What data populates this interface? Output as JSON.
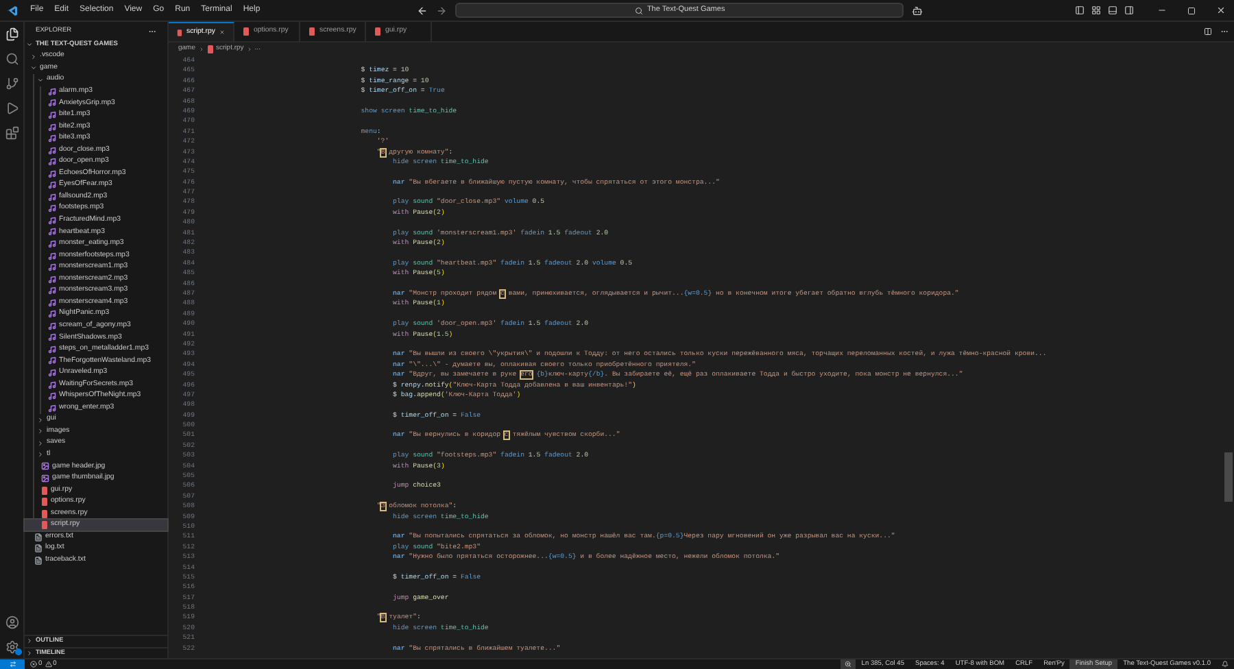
{
  "menu": [
    "File",
    "Edit",
    "Selection",
    "View",
    "Go",
    "Run",
    "Terminal",
    "Help"
  ],
  "search": {
    "value": "The Text-Quest Games"
  },
  "explorer": {
    "title": "EXPLORER",
    "root": "THE TEXT-QUEST GAMES",
    "tree": [
      {
        "label": ".vscode",
        "kind": "folder",
        "expanded": false,
        "selected": false
      },
      {
        "label": "game",
        "kind": "folder",
        "expanded": true,
        "selected": false,
        "children": [
          {
            "label": "audio",
            "kind": "folder",
            "expanded": true,
            "selected": false,
            "children": [
              {
                "label": "alarm.mp3",
                "kind": "audio",
                "selected": false
              },
              {
                "label": "AnxietysGrip.mp3",
                "kind": "audio",
                "selected": false
              },
              {
                "label": "bite1.mp3",
                "kind": "audio",
                "selected": false
              },
              {
                "label": "bite2.mp3",
                "kind": "audio",
                "selected": false
              },
              {
                "label": "bite3.mp3",
                "kind": "audio",
                "selected": false
              },
              {
                "label": "door_close.mp3",
                "kind": "audio",
                "selected": false
              },
              {
                "label": "door_open.mp3",
                "kind": "audio",
                "selected": false
              },
              {
                "label": "EchoesOfHorror.mp3",
                "kind": "audio",
                "selected": false
              },
              {
                "label": "EyesOfFear.mp3",
                "kind": "audio",
                "selected": false
              },
              {
                "label": "fallsound2.mp3",
                "kind": "audio",
                "selected": false
              },
              {
                "label": "footsteps.mp3",
                "kind": "audio",
                "selected": false
              },
              {
                "label": "FracturedMind.mp3",
                "kind": "audio",
                "selected": false
              },
              {
                "label": "heartbeat.mp3",
                "kind": "audio",
                "selected": false
              },
              {
                "label": "monster_eating.mp3",
                "kind": "audio",
                "selected": false
              },
              {
                "label": "monsterfootsteps.mp3",
                "kind": "audio",
                "selected": false
              },
              {
                "label": "monsterscream1.mp3",
                "kind": "audio",
                "selected": false
              },
              {
                "label": "monsterscream2.mp3",
                "kind": "audio",
                "selected": false
              },
              {
                "label": "monsterscream3.mp3",
                "kind": "audio",
                "selected": false
              },
              {
                "label": "monsterscream4.mp3",
                "kind": "audio",
                "selected": false
              },
              {
                "label": "NightPanic.mp3",
                "kind": "audio",
                "selected": false
              },
              {
                "label": "scream_of_agony.mp3",
                "kind": "audio",
                "selected": false
              },
              {
                "label": "SilentShadows.mp3",
                "kind": "audio",
                "selected": false
              },
              {
                "label": "steps_on_metalladder1.mp3",
                "kind": "audio",
                "selected": false
              },
              {
                "label": "TheForgottenWasteland.mp3",
                "kind": "audio",
                "selected": false
              },
              {
                "label": "Unraveled.mp3",
                "kind": "audio",
                "selected": false
              },
              {
                "label": "WaitingForSecrets.mp3",
                "kind": "audio",
                "selected": false
              },
              {
                "label": "WhispersOfTheNight.mp3",
                "kind": "audio",
                "selected": false
              },
              {
                "label": "wrong_enter.mp3",
                "kind": "audio",
                "selected": false
              }
            ]
          },
          {
            "label": "gui",
            "kind": "folder",
            "expanded": false,
            "selected": false
          },
          {
            "label": "images",
            "kind": "folder",
            "expanded": false,
            "selected": false
          },
          {
            "label": "saves",
            "kind": "folder",
            "expanded": false,
            "selected": false
          },
          {
            "label": "tl",
            "kind": "folder",
            "expanded": false,
            "selected": false
          },
          {
            "label": "game header.jpg",
            "kind": "image",
            "selected": false
          },
          {
            "label": "game thumbnail.jpg",
            "kind": "image",
            "selected": false
          },
          {
            "label": "gui.rpy",
            "kind": "renpy",
            "selected": false
          },
          {
            "label": "options.rpy",
            "kind": "renpy",
            "selected": false
          },
          {
            "label": "screens.rpy",
            "kind": "renpy",
            "selected": false
          },
          {
            "label": "script.rpy",
            "kind": "renpy",
            "selected": true
          }
        ]
      },
      {
        "label": "errors.txt",
        "kind": "text",
        "selected": false
      },
      {
        "label": "log.txt",
        "kind": "text",
        "selected": false
      },
      {
        "label": "traceback.txt",
        "kind": "text",
        "selected": false
      }
    ],
    "sections": [
      {
        "label": "OUTLINE",
        "expanded": false
      },
      {
        "label": "TIMELINE",
        "expanded": false
      }
    ]
  },
  "tabs": [
    {
      "label": "script.rpy",
      "selected": true
    },
    {
      "label": "options.rpy",
      "selected": false
    },
    {
      "label": "screens.rpy",
      "selected": false
    },
    {
      "label": "gui.rpy",
      "selected": false
    }
  ],
  "breadcrumb": [
    "game",
    "script.rpy",
    "..."
  ],
  "code": [
    {
      "number": "464"
    },
    {
      "number": "465",
      "tokens": [
        {
          "kind": "plain",
          "text": "$ "
        },
        {
          "kind": "var",
          "text": "timez"
        },
        {
          "kind": "plain",
          "text": " = "
        },
        {
          "kind": "num",
          "text": "10"
        }
      ]
    },
    {
      "number": "466",
      "tokens": [
        {
          "kind": "plain",
          "text": "$ "
        },
        {
          "kind": "var",
          "text": "time_range"
        },
        {
          "kind": "plain",
          "text": " = "
        },
        {
          "kind": "num",
          "text": "10"
        }
      ]
    },
    {
      "number": "467",
      "tokens": [
        {
          "kind": "plain",
          "text": "$ "
        },
        {
          "kind": "var",
          "text": "timer_off_on"
        },
        {
          "kind": "plain",
          "text": " = "
        },
        {
          "kind": "kw",
          "text": "True"
        }
      ]
    },
    {
      "number": "468"
    },
    {
      "number": "469",
      "tokens": [
        {
          "kind": "kw",
          "text": "show "
        },
        {
          "kind": "kw",
          "text": "screen "
        },
        {
          "kind": "name",
          "text": "time_to_hide"
        }
      ]
    },
    {
      "number": "470"
    },
    {
      "number": "471",
      "tokens": [
        {
          "kind": "kw",
          "text": "menu"
        },
        {
          "kind": "plain",
          "text": ":"
        }
      ],
      "children": [
        {
          "number": "472",
          "tokens": [
            {
              "kind": "str",
              "text": "'?'"
            }
          ]
        },
        {
          "number": "473",
          "tokens": [
            {
              "kind": "str",
              "text": "\""
            },
            {
              "kind": "amb",
              "text": "В"
            },
            {
              "kind": "str",
              "text": " другую комнату\""
            },
            {
              "kind": "plain",
              "text": ":"
            }
          ],
          "children": [
            {
              "number": "474",
              "tokens": [
                {
                  "kind": "kw",
                  "text": "hide "
                },
                {
                  "kind": "kw",
                  "text": "screen "
                },
                {
                  "kind": "name",
                  "text": "time_to_hide"
                }
              ]
            },
            {
              "number": "475"
            },
            {
              "number": "476",
              "tokens": [
                {
                  "kind": "char",
                  "text": "nar "
                },
                {
                  "kind": "str",
                  "text": "\"Вы вбегаете в ближайшую пустую комнату, чтобы спрятаться от этого монстра...\""
                }
              ]
            },
            {
              "number": "477"
            },
            {
              "number": "478",
              "tokens": [
                {
                  "kind": "kw",
                  "text": "play "
                },
                {
                  "kind": "name",
                  "text": "sound "
                },
                {
                  "kind": "str",
                  "text": "\"door_close.mp3\" "
                },
                {
                  "kind": "kw",
                  "text": "volume "
                },
                {
                  "kind": "num",
                  "text": "0.5"
                }
              ]
            },
            {
              "number": "479",
              "tokens": [
                {
                  "kind": "ctrl",
                  "text": "with "
                },
                {
                  "kind": "fn",
                  "text": "Pause"
                },
                {
                  "kind": "paren",
                  "text": "("
                },
                {
                  "kind": "num",
                  "text": "2"
                },
                {
                  "kind": "paren",
                  "text": ")"
                }
              ]
            },
            {
              "number": "480"
            },
            {
              "number": "481",
              "tokens": [
                {
                  "kind": "kw",
                  "text": "play "
                },
                {
                  "kind": "name",
                  "text": "sound "
                },
                {
                  "kind": "str",
                  "text": "'monsterscream1.mp3' "
                },
                {
                  "kind": "kw",
                  "text": "fadein "
                },
                {
                  "kind": "num",
                  "text": "1.5 "
                },
                {
                  "kind": "kw",
                  "text": "fadeout "
                },
                {
                  "kind": "num",
                  "text": "2.0"
                }
              ]
            },
            {
              "number": "482",
              "tokens": [
                {
                  "kind": "ctrl",
                  "text": "with "
                },
                {
                  "kind": "fn",
                  "text": "Pause"
                },
                {
                  "kind": "paren",
                  "text": "("
                },
                {
                  "kind": "num",
                  "text": "2"
                },
                {
                  "kind": "paren",
                  "text": ")"
                }
              ]
            },
            {
              "number": "483"
            },
            {
              "number": "484",
              "tokens": [
                {
                  "kind": "kw",
                  "text": "play "
                },
                {
                  "kind": "name",
                  "text": "sound "
                },
                {
                  "kind": "str",
                  "text": "\"heartbeat.mp3\" "
                },
                {
                  "kind": "kw",
                  "text": "fadein "
                },
                {
                  "kind": "num",
                  "text": "1.5 "
                },
                {
                  "kind": "kw",
                  "text": "fadeout "
                },
                {
                  "kind": "num",
                  "text": "2.0 "
                },
                {
                  "kind": "kw",
                  "text": "volume "
                },
                {
                  "kind": "num",
                  "text": "0.5"
                }
              ]
            },
            {
              "number": "485",
              "tokens": [
                {
                  "kind": "ctrl",
                  "text": "with "
                },
                {
                  "kind": "fn",
                  "text": "Pause"
                },
                {
                  "kind": "paren",
                  "text": "("
                },
                {
                  "kind": "num",
                  "text": "5"
                },
                {
                  "kind": "paren",
                  "text": ")"
                }
              ]
            },
            {
              "number": "486"
            },
            {
              "number": "487",
              "tokens": [
                {
                  "kind": "char",
                  "text": "nar "
                },
                {
                  "kind": "str",
                  "text": "\"Монстр проходит рядом "
                },
                {
                  "kind": "amb",
                  "text": "с"
                },
                {
                  "kind": "str",
                  "text": " вами, принюхивается, оглядывается и рычит..."
                },
                {
                  "kind": "tag",
                  "text": "{w=0.5}"
                },
                {
                  "kind": "str",
                  "text": " но в конечном итоге убегает обратно вглубь тёмного коридора.\""
                }
              ]
            },
            {
              "number": "488",
              "tokens": [
                {
                  "kind": "ctrl",
                  "text": "with "
                },
                {
                  "kind": "fn",
                  "text": "Pause"
                },
                {
                  "kind": "paren",
                  "text": "("
                },
                {
                  "kind": "num",
                  "text": "1"
                },
                {
                  "kind": "paren",
                  "text": ")"
                }
              ]
            },
            {
              "number": "489"
            },
            {
              "number": "490",
              "tokens": [
                {
                  "kind": "kw",
                  "text": "play "
                },
                {
                  "kind": "name",
                  "text": "sound "
                },
                {
                  "kind": "str",
                  "text": "'door_open.mp3' "
                },
                {
                  "kind": "kw",
                  "text": "fadein "
                },
                {
                  "kind": "num",
                  "text": "1.5 "
                },
                {
                  "kind": "kw",
                  "text": "fadeout "
                },
                {
                  "kind": "num",
                  "text": "2.0"
                }
              ]
            },
            {
              "number": "491",
              "tokens": [
                {
                  "kind": "ctrl",
                  "text": "with "
                },
                {
                  "kind": "fn",
                  "text": "Pause"
                },
                {
                  "kind": "paren",
                  "text": "("
                },
                {
                  "kind": "num",
                  "text": "1.5"
                },
                {
                  "kind": "paren",
                  "text": ")"
                }
              ]
            },
            {
              "number": "492"
            },
            {
              "number": "493",
              "tokens": [
                {
                  "kind": "char",
                  "text": "nar "
                },
                {
                  "kind": "str",
                  "text": "\"Вы вышли из своего \\\"укрытия\\\" и подошли к Тодду: от него остались только куски пережёванного мяса, торчащих переломанных костей, и лужа тёмно-красной крови..."
                }
              ]
            },
            {
              "number": "494",
              "tokens": [
                {
                  "kind": "char",
                  "text": "nar "
                },
                {
                  "kind": "str",
                  "text": "\"\\\"...\\\" - думаете вы, оплакивая своего только приобретённого приятеля.\""
                }
              ]
            },
            {
              "number": "495",
              "tokens": [
                {
                  "kind": "char",
                  "text": "nar "
                },
                {
                  "kind": "str",
                  "text": "\"Вдруг, вы замечаете в руке "
                },
                {
                  "kind": "amb",
                  "text": "его"
                },
                {
                  "kind": "tag",
                  "text": " {b}"
                },
                {
                  "kind": "str",
                  "text": "ключ-карту"
                },
                {
                  "kind": "tag",
                  "text": "{/b}"
                },
                {
                  "kind": "str",
                  "text": ". Вы забираете её, ещё раз оплакиваете Тодда и быстро уходите, пока монстр не вернулся...\""
                }
              ]
            },
            {
              "number": "496",
              "tokens": [
                {
                  "kind": "plain",
                  "text": "$ "
                },
                {
                  "kind": "var",
                  "text": "renpy"
                },
                {
                  "kind": "plain",
                  "text": "."
                },
                {
                  "kind": "fn",
                  "text": "notify"
                },
                {
                  "kind": "paren",
                  "text": "("
                },
                {
                  "kind": "str",
                  "text": "\"Ключ-Карта Тодда добавлена в ваш инвентарь!\""
                },
                {
                  "kind": "paren",
                  "text": ")"
                }
              ]
            },
            {
              "number": "497",
              "tokens": [
                {
                  "kind": "plain",
                  "text": "$ "
                },
                {
                  "kind": "var",
                  "text": "bag"
                },
                {
                  "kind": "plain",
                  "text": "."
                },
                {
                  "kind": "fn",
                  "text": "append"
                },
                {
                  "kind": "paren",
                  "text": "("
                },
                {
                  "kind": "str",
                  "text": "'Ключ-Карта Тодда'"
                },
                {
                  "kind": "paren",
                  "text": ")"
                }
              ]
            },
            {
              "number": "498"
            },
            {
              "number": "499",
              "tokens": [
                {
                  "kind": "plain",
                  "text": "$ "
                },
                {
                  "kind": "var",
                  "text": "timer_off_on"
                },
                {
                  "kind": "plain",
                  "text": " = "
                },
                {
                  "kind": "kw",
                  "text": "False"
                }
              ]
            },
            {
              "number": "500"
            },
            {
              "number": "501",
              "tokens": [
                {
                  "kind": "char",
                  "text": "nar "
                },
                {
                  "kind": "str",
                  "text": "\"Вы вернулись в коридор "
                },
                {
                  "kind": "amb",
                  "text": "с"
                },
                {
                  "kind": "str",
                  "text": " тяжёлым чувством скорби...\""
                }
              ]
            },
            {
              "number": "502"
            },
            {
              "number": "503",
              "tokens": [
                {
                  "kind": "kw",
                  "text": "play "
                },
                {
                  "kind": "name",
                  "text": "sound "
                },
                {
                  "kind": "str",
                  "text": "\"footsteps.mp3\" "
                },
                {
                  "kind": "kw",
                  "text": "fadein "
                },
                {
                  "kind": "num",
                  "text": "1.5 "
                },
                {
                  "kind": "kw",
                  "text": "fadeout "
                },
                {
                  "kind": "num",
                  "text": "2.0"
                }
              ]
            },
            {
              "number": "504",
              "tokens": [
                {
                  "kind": "ctrl",
                  "text": "with "
                },
                {
                  "kind": "fn",
                  "text": "Pause"
                },
                {
                  "kind": "paren",
                  "text": "("
                },
                {
                  "kind": "num",
                  "text": "3"
                },
                {
                  "kind": "paren",
                  "text": ")"
                }
              ]
            },
            {
              "number": "505"
            },
            {
              "number": "506",
              "tokens": [
                {
                  "kind": "ctrl",
                  "text": "jump "
                },
                {
                  "kind": "fn",
                  "text": "choice3"
                }
              ]
            },
            {
              "number": "507"
            }
          ]
        },
        {
          "number": "508",
          "tokens": [
            {
              "kind": "str",
              "text": "\""
            },
            {
              "kind": "amb",
              "text": "З"
            },
            {
              "kind": "str",
              "text": " обломок потолка\""
            },
            {
              "kind": "plain",
              "text": ":"
            }
          ],
          "children": [
            {
              "number": "509",
              "tokens": [
                {
                  "kind": "kw",
                  "text": "hide "
                },
                {
                  "kind": "kw",
                  "text": "screen "
                },
                {
                  "kind": "name",
                  "text": "time_to_hide"
                }
              ]
            },
            {
              "number": "510"
            },
            {
              "number": "511",
              "tokens": [
                {
                  "kind": "char",
                  "text": "nar "
                },
                {
                  "kind": "str",
                  "text": "\"Вы попытались спрятаться за обломок, но монстр нашёл вас там."
                },
                {
                  "kind": "tag",
                  "text": "{p=0.5}"
                },
                {
                  "kind": "str",
                  "text": "Через пару мгновений он уже разрывал вас на куски...\""
                }
              ]
            },
            {
              "number": "512",
              "tokens": [
                {
                  "kind": "kw",
                  "text": "play "
                },
                {
                  "kind": "name",
                  "text": "sound "
                },
                {
                  "kind": "str",
                  "text": "\"bite2.mp3\""
                }
              ]
            },
            {
              "number": "513",
              "tokens": [
                {
                  "kind": "char",
                  "text": "nar "
                },
                {
                  "kind": "str",
                  "text": "\"Нужно было прятаться осторожнее..."
                },
                {
                  "kind": "tag",
                  "text": "{w=0.5}"
                },
                {
                  "kind": "str",
                  "text": " и в более надёжное место, нежели обломок потолка.\""
                }
              ]
            },
            {
              "number": "514"
            },
            {
              "number": "515",
              "tokens": [
                {
                  "kind": "plain",
                  "text": "$ "
                },
                {
                  "kind": "var",
                  "text": "timer_off_on"
                },
                {
                  "kind": "plain",
                  "text": " = "
                },
                {
                  "kind": "kw",
                  "text": "False"
                }
              ]
            },
            {
              "number": "516"
            },
            {
              "number": "517",
              "tokens": [
                {
                  "kind": "ctrl",
                  "text": "jump "
                },
                {
                  "kind": "fn",
                  "text": "game_over"
                }
              ]
            },
            {
              "number": "518"
            }
          ]
        },
        {
          "number": "519",
          "tokens": [
            {
              "kind": "str",
              "text": "\""
            },
            {
              "kind": "amb",
              "text": "В"
            },
            {
              "kind": "str",
              "text": " туалет\""
            },
            {
              "kind": "plain",
              "text": ":"
            }
          ],
          "children": [
            {
              "number": "520",
              "tokens": [
                {
                  "kind": "kw",
                  "text": "hide "
                },
                {
                  "kind": "kw",
                  "text": "screen "
                },
                {
                  "kind": "name",
                  "text": "time_to_hide"
                }
              ]
            },
            {
              "number": "521"
            },
            {
              "number": "522",
              "tokens": [
                {
                  "kind": "char",
                  "text": "nar "
                },
                {
                  "kind": "str",
                  "text": "\"Вы спрятались в ближайшем туалете...\""
                }
              ]
            }
          ]
        }
      ]
    }
  ],
  "status_bar": {
    "errors": "0",
    "warnings": "0",
    "items": [
      "Ln 385, Col 45",
      "Spaces: 4",
      "UTF-8 with BOM",
      "CRLF",
      "Ren'Py",
      "Finish Setup",
      "The Text-Quest Games v0.1.0"
    ]
  }
}
